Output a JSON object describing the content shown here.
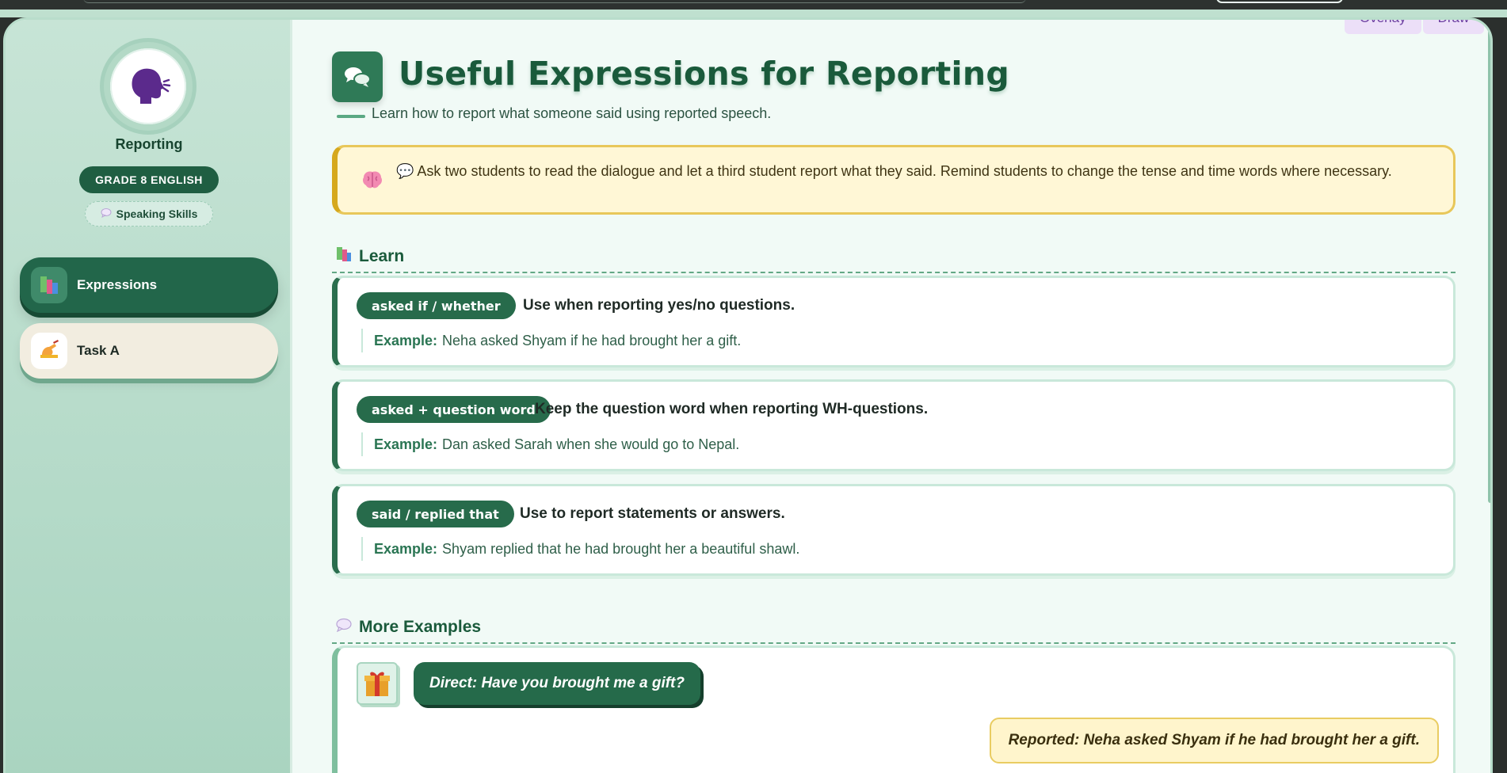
{
  "toolbar": {
    "overlay_label": "Overlay",
    "draw_label": "Draw"
  },
  "sidebar": {
    "avatar_icon": "speaking-head-icon",
    "title": "Reporting",
    "grade_badge": "GRADE 8 ENGLISH",
    "skill_chip": {
      "icon": "speech-bubble-icon",
      "label": "Speaking Skills"
    },
    "items": [
      {
        "label": "Expressions",
        "icon": "books-icon",
        "active": true
      },
      {
        "label": "Task A",
        "icon": "writing-hand-icon",
        "active": false
      }
    ]
  },
  "main": {
    "title": "Useful Expressions for Reporting",
    "title_icon": "speech-bubbles-icon",
    "subtitle": "Learn how to report what someone said using reported speech.",
    "tip": {
      "icon": "brain-icon",
      "text": "💬 Ask two students to read the dialogue and let a third student report what they said. Remind students to change the tense and time words where necessary."
    },
    "learn_section": {
      "icon": "books-icon",
      "title": "Learn",
      "cards": [
        {
          "phrase": "asked if / whether",
          "description": "Use when reporting yes/no questions.",
          "example_label": "Example:",
          "example": "Neha asked Shyam if he had brought her a gift."
        },
        {
          "phrase": "asked + question word",
          "description": "Keep the question word when reporting WH-questions.",
          "example_label": "Example:",
          "example": "Dan asked Sarah when she would go to Nepal."
        },
        {
          "phrase": "said / replied that",
          "description": "Use to report statements or answers.",
          "example_label": "Example:",
          "example": "Shyam replied that he had brought her a beautiful shawl."
        }
      ]
    },
    "more_section": {
      "icon": "speech-bubble-icon",
      "title": "More Examples",
      "example": {
        "icon": "gift-icon",
        "direct": "Direct: Have you brought me a gift?",
        "reported": "Reported: Neha asked Shyam if he had brought her a gift."
      }
    }
  },
  "colors": {
    "brand_green": "#1f5e42",
    "tip_yellow": "#fff7d6",
    "accent_purple": "#6b3fa0"
  }
}
